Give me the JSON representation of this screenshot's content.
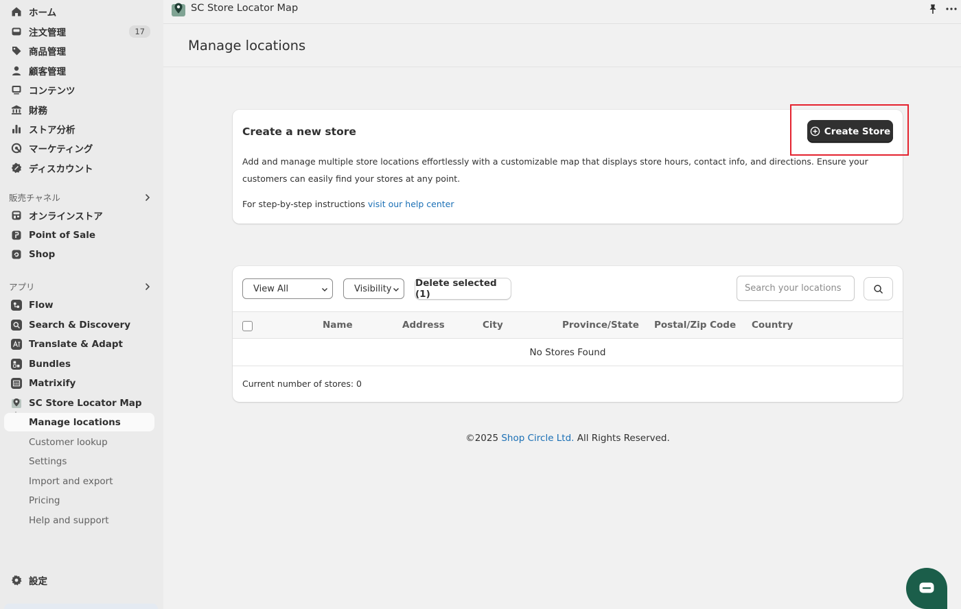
{
  "sidebar": {
    "main_items": [
      {
        "label": "ホーム",
        "icon": "home-icon"
      },
      {
        "label": "注文管理",
        "icon": "inbox-icon",
        "badge": "17"
      },
      {
        "label": "商品管理",
        "icon": "tag-icon"
      },
      {
        "label": "顧客管理",
        "icon": "person-icon"
      },
      {
        "label": "コンテンツ",
        "icon": "image-icon"
      },
      {
        "label": "財務",
        "icon": "bank-icon"
      },
      {
        "label": "ストア分析",
        "icon": "bar-chart-icon"
      },
      {
        "label": "マーケティング",
        "icon": "target-icon"
      },
      {
        "label": "ディスカウント",
        "icon": "discount-icon"
      }
    ],
    "sales_channels_label": "販売チャネル",
    "sales_channels": [
      {
        "label": "オンラインストア",
        "icon": "store-icon"
      },
      {
        "label": "Point of Sale",
        "icon": "pos-icon"
      },
      {
        "label": "Shop",
        "icon": "shop-icon"
      }
    ],
    "apps_label": "アプリ",
    "apps": [
      {
        "label": "Flow",
        "icon": "flow-icon"
      },
      {
        "label": "Search & Discovery",
        "icon": "search-discovery-icon"
      },
      {
        "label": "Translate & Adapt",
        "icon": "translate-icon"
      },
      {
        "label": "Bundles",
        "icon": "bundles-icon"
      },
      {
        "label": "Matrixify",
        "icon": "matrixify-icon"
      },
      {
        "label": "SC Store Locator Map",
        "icon": "map-pin-icon"
      }
    ],
    "sub_items": [
      {
        "label": "Manage locations",
        "active": true
      },
      {
        "label": "Customer lookup"
      },
      {
        "label": "Settings"
      },
      {
        "label": "Import and export"
      },
      {
        "label": "Pricing"
      },
      {
        "label": "Help and support"
      }
    ],
    "settings_label": "設定"
  },
  "topbar": {
    "app_title": "SC Store Locator Map"
  },
  "page": {
    "title": "Manage locations"
  },
  "create_card": {
    "title": "Create a new store",
    "button_label": "Create Store",
    "description": "Add and manage multiple store locations effortlessly with a customizable map that displays store hours, contact info, and directions. Ensure your customers can easily find your stores at any point.",
    "help_prefix": "For step-by-step instructions ",
    "help_link": "visit our help center"
  },
  "table_card": {
    "view_select": "View All",
    "visibility_select": "Visibility",
    "delete_button": "Delete selected (1)",
    "search_placeholder": "Search your locations",
    "columns": [
      "Name",
      "Address",
      "City",
      "Province/State",
      "Postal/Zip Code",
      "Country"
    ],
    "empty_text": "No Stores Found",
    "count_text": "Current number of stores: 0"
  },
  "footer": {
    "prefix": "©2025 ",
    "link": "Shop Circle Ltd.",
    "suffix": " All Rights Reserved."
  },
  "colors": {
    "accent": "#303030",
    "link": "#1a6fb5",
    "highlight": "#e4222e",
    "chat": "#1b5e4a"
  }
}
